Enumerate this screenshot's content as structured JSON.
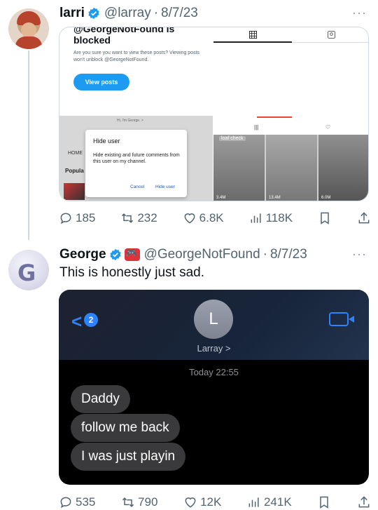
{
  "tweets": [
    {
      "name": "larri",
      "handle": "@larray",
      "date": "8/7/23",
      "more": "···",
      "media": {
        "title": "@GeorgeNotFound is blocked",
        "subtitle": "Are you sure you want to view these posts? Viewing posts won't unblock @GeorgeNotFound.",
        "button": "View posts",
        "yt_greeting": "Hi, I'm George.  >",
        "home": "HOME",
        "popular": "Popula",
        "dialog": {
          "title": "Hide user",
          "desc": "Hide existing and future comments from this user on my channel.",
          "cancel": "Cancel",
          "confirm": "Hide user"
        },
        "grid_caption": "loaf check",
        "grid_views": [
          "3.4M",
          "13.4M",
          "6.0M"
        ]
      },
      "stats": {
        "replies": "185",
        "retweets": "232",
        "likes": "6.8K",
        "views": "118K"
      }
    },
    {
      "name": "George",
      "handle": "@GeorgeNotFound",
      "date": "8/7/23",
      "more": "···",
      "text": "This is honestly just sad.",
      "media": {
        "back_count": "2",
        "contact_initial": "L",
        "contact_name": "Larray >",
        "timestamp": "Today 22:55",
        "messages": [
          "Daddy",
          "follow me back",
          "I was just playin"
        ]
      },
      "stats": {
        "replies": "535",
        "retweets": "790",
        "likes": "12K",
        "views": "241K"
      }
    }
  ],
  "colors": {
    "accent": "#1d9bf0",
    "muted": "#536471",
    "imessage_blue": "#2c83ff"
  }
}
